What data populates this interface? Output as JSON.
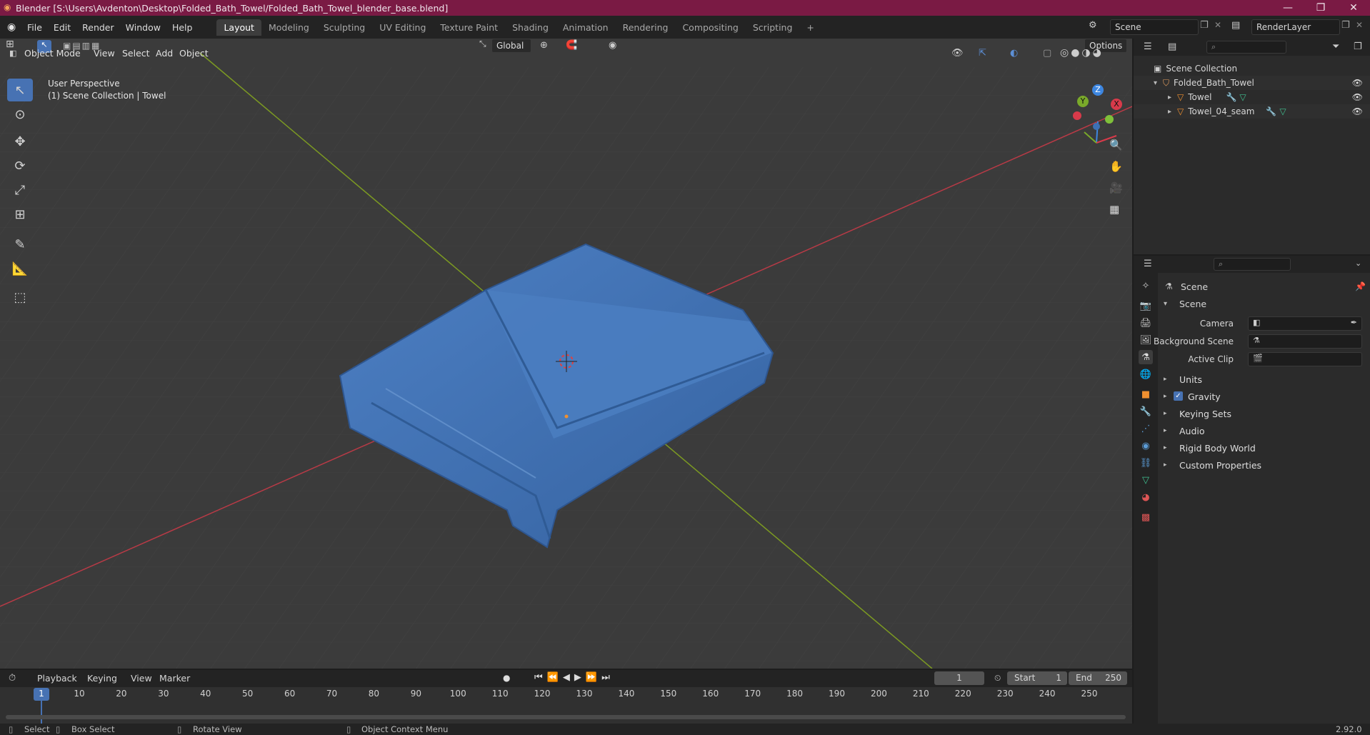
{
  "window": {
    "title": "Blender [S:\\Users\\Avdenton\\Desktop\\Folded_Bath_Towel/Folded_Bath_Towel_blender_base.blend]",
    "minimize": "—",
    "restore": "❐",
    "close": "✕"
  },
  "menu": [
    "File",
    "Edit",
    "Render",
    "Window",
    "Help"
  ],
  "workspaces": [
    "Layout",
    "Modeling",
    "Sculpting",
    "UV Editing",
    "Texture Paint",
    "Shading",
    "Animation",
    "Rendering",
    "Compositing",
    "Scripting"
  ],
  "workspace_add": "+",
  "scene_selector": {
    "value": "Scene"
  },
  "renderlayer_selector": {
    "value": "RenderLayer"
  },
  "viewport": {
    "mode": "Object Mode",
    "menus": [
      "View",
      "Select",
      "Add",
      "Object"
    ],
    "orientation": "Global",
    "options": "Options",
    "overlay_line1": "User Perspective",
    "overlay_line2": "(1) Scene Collection | Towel",
    "gizmo": {
      "z": "Z",
      "y": "Y",
      "x": "X"
    }
  },
  "outliner": {
    "root": "Scene Collection",
    "collection": "Folded_Bath_Towel",
    "objects": [
      "Towel",
      "Towel_04_seam"
    ]
  },
  "properties": {
    "header": "Scene",
    "section": "Scene",
    "fields": [
      {
        "label": "Camera",
        "value": ""
      },
      {
        "label": "Background Scene",
        "value": ""
      },
      {
        "label": "Active Clip",
        "value": ""
      }
    ],
    "panels": [
      "Units",
      "Gravity",
      "Keying Sets",
      "Audio",
      "Rigid Body World",
      "Custom Properties"
    ],
    "gravity_checked": true
  },
  "timeline": {
    "menus": [
      "Playback",
      "Keying",
      "View",
      "Marker"
    ],
    "current_frame": "1",
    "start_label": "Start",
    "start": "1",
    "end_label": "End",
    "end": "250",
    "ticks": [
      "1",
      "10",
      "20",
      "30",
      "40",
      "50",
      "60",
      "70",
      "80",
      "90",
      "100",
      "110",
      "120",
      "130",
      "140",
      "150",
      "160",
      "170",
      "180",
      "190",
      "200",
      "210",
      "220",
      "230",
      "240",
      "250"
    ]
  },
  "status": {
    "select": "Select",
    "box_select": "Box Select",
    "rotate_view": "Rotate View",
    "context_menu": "Object Context Menu",
    "version": "2.92.0"
  },
  "colors": {
    "titlebar": "#7a1a44",
    "accent": "#4772b3",
    "towel": "#3f6fb0",
    "axis_x": "#b83a46",
    "axis_y": "#7c9a22"
  }
}
